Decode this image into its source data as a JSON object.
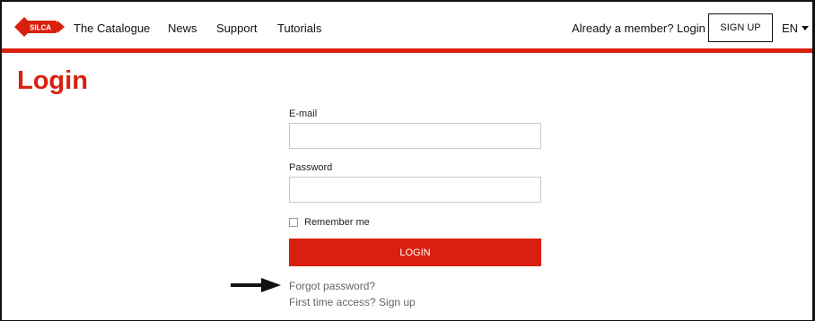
{
  "nav": {
    "logo_text": "SILCA",
    "links": [
      "The Catalogue",
      "News",
      "Support",
      "Tutorials"
    ],
    "member_login": "Already a member? Login",
    "signup": "SIGN UP",
    "language": "EN"
  },
  "page": {
    "title": "Login"
  },
  "form": {
    "email_label": "E-mail",
    "email_value": "",
    "password_label": "Password",
    "password_value": "",
    "remember_label": "Remember me",
    "remember_checked": false,
    "login_button": "LOGIN",
    "forgot_password": "Forgot password?",
    "first_time": "First time access? Sign up"
  },
  "colors": {
    "accent": "#d9200f"
  },
  "icons": {
    "arrow": "arrow-right-icon",
    "language_caret": "caret-down-icon"
  }
}
